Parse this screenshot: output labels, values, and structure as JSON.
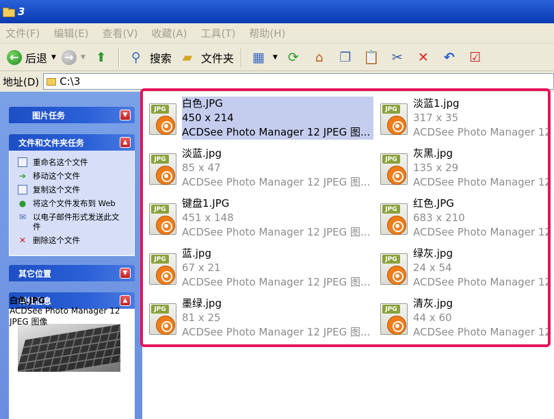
{
  "window": {
    "title": "3"
  },
  "menu": [
    "文件(F)",
    "编辑(E)",
    "查看(V)",
    "收藏(A)",
    "工具(T)",
    "帮助(H)"
  ],
  "toolbar": {
    "back_label": "后退",
    "search_label": "搜索",
    "folders_label": "文件夹"
  },
  "address": {
    "label": "地址(D)",
    "value": "C:\\3"
  },
  "left_pane": {
    "picture_tasks": {
      "title": "图片任务"
    },
    "file_tasks": {
      "title": "文件和文件夹任务",
      "items": [
        "重命名这个文件",
        "移动这个文件",
        "复制这个文件",
        "将这个文件发布到 Web",
        "以电子邮件形式发送此文件",
        "删除这个文件"
      ]
    },
    "other_places": {
      "title": "其它位置"
    },
    "details": {
      "title": "详细信息",
      "name": "白色.JPG",
      "type": "ACDSee Photo Manager 12 JPEG 图像"
    }
  },
  "files": [
    {
      "name": "白色.JPG",
      "dims": "450 x 214",
      "type": "ACDSee Photo Manager 12 JPEG 图...",
      "selected": true
    },
    {
      "name": "淡蓝1.jpg",
      "dims": "317 x 35",
      "type": "ACDSee Photo Manager 12",
      "selected": false
    },
    {
      "name": "淡蓝.jpg",
      "dims": "85 x 47",
      "type": "ACDSee Photo Manager 12 JPEG 图...",
      "selected": false
    },
    {
      "name": "灰黑.jpg",
      "dims": "135 x 29",
      "type": "ACDSee Photo Manager 12",
      "selected": false
    },
    {
      "name": "键盘1.JPG",
      "dims": "451 x 148",
      "type": "ACDSee Photo Manager 12 JPEG 图...",
      "selected": false
    },
    {
      "name": "红色.JPG",
      "dims": "683 x 210",
      "type": "ACDSee Photo Manager 12",
      "selected": false
    },
    {
      "name": "蓝.jpg",
      "dims": "67 x 21",
      "type": "ACDSee Photo Manager 12 JPEG 图...",
      "selected": false
    },
    {
      "name": "绿灰.jpg",
      "dims": "24 x 54",
      "type": "ACDSee Photo Manager 12",
      "selected": false
    },
    {
      "name": "墨绿.jpg",
      "dims": "81 x 25",
      "type": "ACDSee Photo Manager 12 JPEG 图...",
      "selected": false
    },
    {
      "name": "清灰.jpg",
      "dims": "44 x 60",
      "type": "ACDSee Photo Manager 12",
      "selected": false
    }
  ],
  "file_tag": "JPG",
  "colors": {
    "titlebar": "#1a4fc8",
    "highlight_frame": "#e4145a",
    "selection": "#c5cdee"
  }
}
